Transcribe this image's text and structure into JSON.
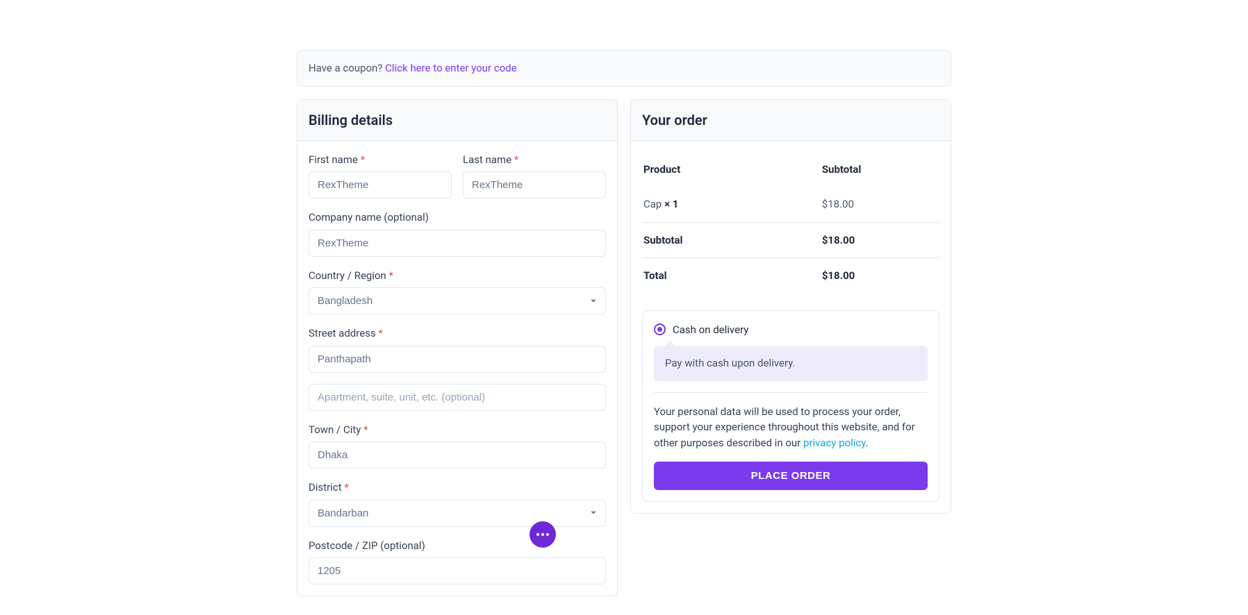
{
  "coupon": {
    "prompt": "Have a coupon? ",
    "link": "Click here to enter your code"
  },
  "billing": {
    "heading": "Billing details",
    "first_name": {
      "label": "First name",
      "value": "RexTheme"
    },
    "last_name": {
      "label": "Last name",
      "value": "RexTheme"
    },
    "company": {
      "label": "Company name (optional)",
      "value": "RexTheme"
    },
    "country": {
      "label": "Country / Region",
      "value": "Bangladesh"
    },
    "street1": {
      "label": "Street address",
      "value": "Panthapath"
    },
    "street2_placeholder": "Apartment, suite, unit, etc. (optional)",
    "city": {
      "label": "Town / City",
      "value": "Dhaka"
    },
    "district": {
      "label": "District",
      "value": "Bandarban"
    },
    "postcode": {
      "label": "Postcode / ZIP (optional)",
      "value": "1205"
    }
  },
  "order": {
    "heading": "Your order",
    "columns": {
      "product": "Product",
      "subtotal": "Subtotal"
    },
    "item": {
      "name": "Cap",
      "qty_prefix": "  × ",
      "qty": "1",
      "price": "$18.00"
    },
    "subtotal": {
      "label": "Subtotal",
      "value": "$18.00"
    },
    "total": {
      "label": "Total",
      "value": "$18.00"
    }
  },
  "payment": {
    "method_label": "Cash on delivery",
    "description": "Pay with cash upon delivery.",
    "privacy_prefix": "Your personal data will be used to process your order, support your experience throughout this website, and for other purposes described in our ",
    "privacy_link": "privacy policy",
    "privacy_suffix": ".",
    "button": "PLACE ORDER"
  }
}
